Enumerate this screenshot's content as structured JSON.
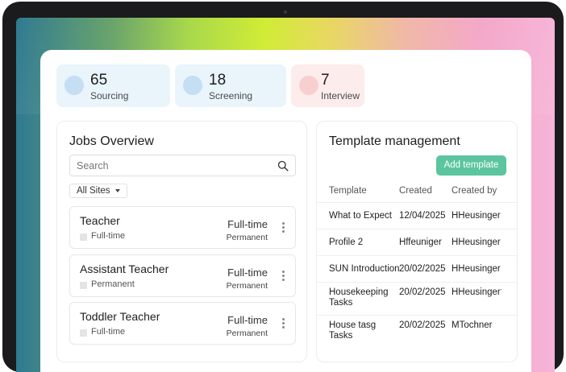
{
  "stats": [
    {
      "value": "65",
      "label": "Sourcing",
      "color": "#e9f4fb",
      "dot": "#c5def3"
    },
    {
      "value": "18",
      "label": "Screening",
      "color": "#e9f4fb",
      "dot": "#c5def3"
    },
    {
      "value": "7",
      "label": "Interview",
      "color": "#fdecec",
      "dot": "#f8cfcf"
    }
  ],
  "jobs_overview": {
    "title": "Jobs Overview",
    "search_placeholder": "Search",
    "site_filter": "All Sites",
    "jobs": [
      {
        "title": "Teacher",
        "sub": "Full-time",
        "type": "Full-time",
        "contract": "Permanent"
      },
      {
        "title": "Assistant Teacher",
        "sub": "Permanent",
        "type": "Full-time",
        "contract": "Permanent"
      },
      {
        "title": "Toddler Teacher",
        "sub": "Full-time",
        "type": "Full-time",
        "contract": "Permanent"
      }
    ]
  },
  "template_management": {
    "title": "Template management",
    "add_label": "Add template",
    "columns": [
      "Template",
      "Created",
      "Created by"
    ],
    "rows": [
      {
        "template": "What to Expect",
        "created": "12/04/2025",
        "by": "HHeusinger"
      },
      {
        "template": "Profile 2",
        "created": "Hffeuniger",
        "by": "HHeusinger"
      },
      {
        "template": "SUN Introduction",
        "created": "20/02/2025",
        "by": "HHeusinger"
      },
      {
        "template": "Housekeeping Tasks",
        "created": "20/02/2025",
        "by": "HHeusinger†"
      },
      {
        "template": "House tasg Tasks",
        "created": "20/02/2025",
        "by": "MTochner"
      }
    ]
  },
  "colors": {
    "accent": "#5bc5a0"
  }
}
